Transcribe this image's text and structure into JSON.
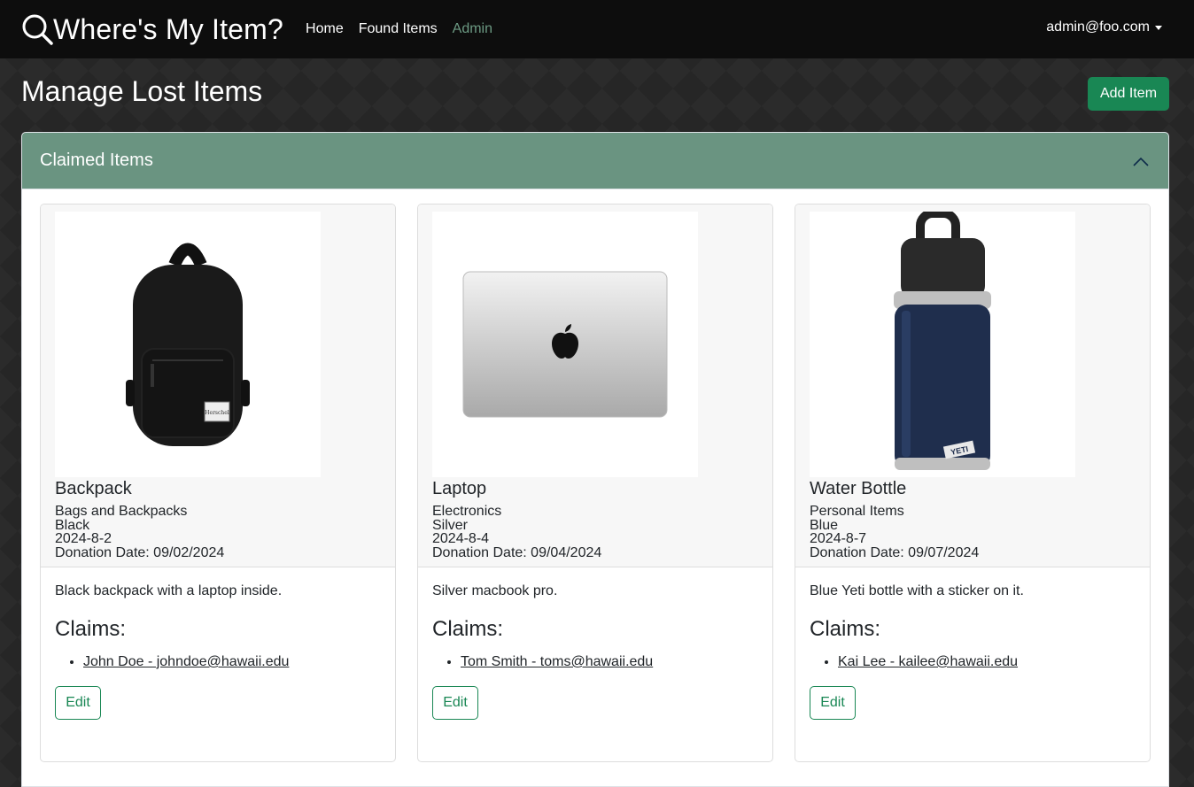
{
  "nav": {
    "brand": "Where's My Item?",
    "links": [
      "Home",
      "Found Items",
      "Admin"
    ],
    "user": "admin@foo.com"
  },
  "page": {
    "title": "Manage Lost Items",
    "add_button": "Add Item"
  },
  "accordion": {
    "title": "Claimed Items"
  },
  "cards": [
    {
      "title": "Backpack",
      "category": "Bags and Backpacks",
      "color": "Black",
      "date": "2024-8-2",
      "donation": "Donation Date: 09/02/2024",
      "description": "Black backpack with a laptop inside.",
      "claims_label": "Claims:",
      "claim": "John Doe - johndoe@hawaii.edu",
      "edit": "Edit"
    },
    {
      "title": "Laptop",
      "category": "Electronics",
      "color": "Silver",
      "date": "2024-8-4",
      "donation": "Donation Date: 09/04/2024",
      "description": "Silver macbook pro.",
      "claims_label": "Claims:",
      "claim": "Tom Smith - toms@hawaii.edu",
      "edit": "Edit"
    },
    {
      "title": "Water Bottle",
      "category": "Personal Items",
      "color": "Blue",
      "date": "2024-8-7",
      "donation": "Donation Date: 09/07/2024",
      "description": "Blue Yeti bottle with a sticker on it.",
      "claims_label": "Claims:",
      "claim": "Kai Lee - kailee@hawaii.edu",
      "edit": "Edit"
    }
  ],
  "images": {
    "backpack_label": "Herschel",
    "bottle_label": "YETI"
  },
  "colors": {
    "accent_green": "#198754",
    "accordion_header": "#6a9481",
    "nav_active": "#6c9a83"
  }
}
